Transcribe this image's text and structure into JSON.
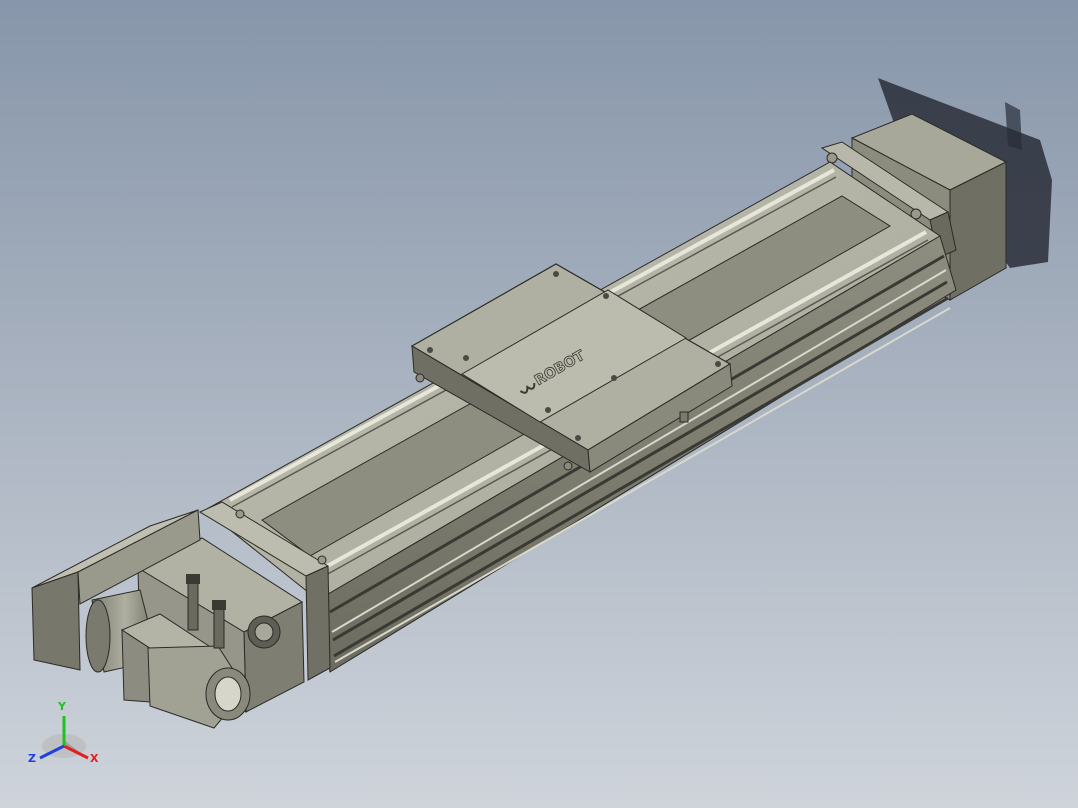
{
  "viewport": {
    "background_top": "#8796aa",
    "background_bottom": "#cfd4db"
  },
  "model": {
    "body_color": "#8a8a7c",
    "top_face_color": "#b6b6a8",
    "dark_face_color": "#5a5a52",
    "shadow_color": "#2a2e3a",
    "logo_text": "ROBOT"
  },
  "axis_triad": {
    "x_label": "X",
    "y_label": "Y",
    "z_label": "Z",
    "x_color": "#e02020",
    "y_color": "#20c020",
    "z_color": "#2040e0"
  }
}
